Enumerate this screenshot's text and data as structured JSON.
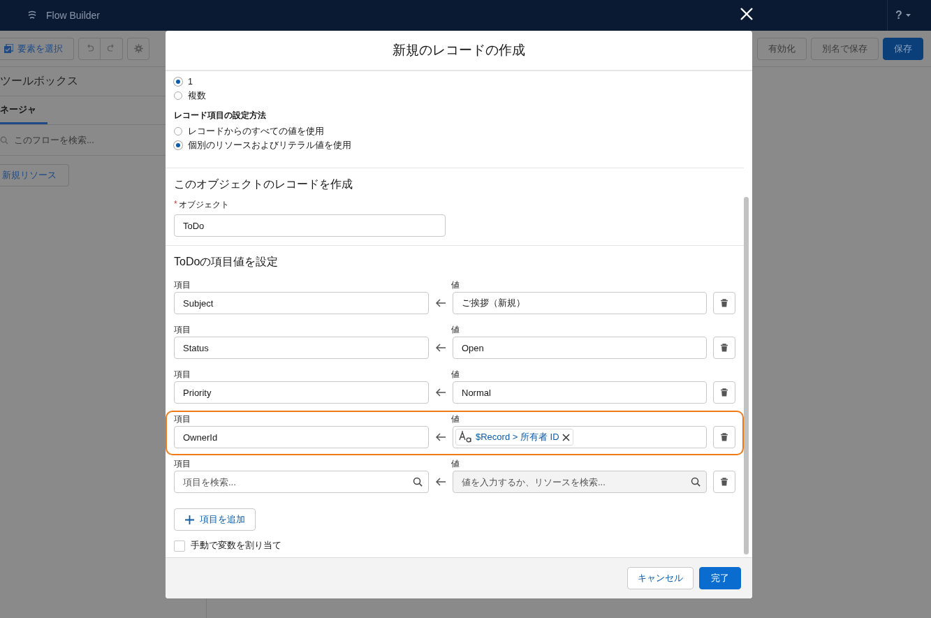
{
  "app_header": {
    "title": "Flow Builder",
    "help": "?"
  },
  "toolbar": {
    "select_button": "要素を選択",
    "right_buttons": [
      {
        "label": "有効化",
        "kind": "plain"
      },
      {
        "label": "別名で保存",
        "kind": "plain"
      },
      {
        "label": "保存",
        "kind": "primary"
      }
    ]
  },
  "sidebar": {
    "title": "ツールボックス",
    "tab": "ネージャ",
    "search": {
      "placeholder": "このフローを検索..."
    },
    "new_resource": "新規リソース"
  },
  "modal": {
    "title": "新規のレコードの作成",
    "record_count": [
      {
        "label": "1",
        "selected": true
      },
      {
        "label": "複数",
        "selected": false
      }
    ],
    "set_method": {
      "label": "レコード項目の設定方法",
      "options": [
        {
          "label": "レコードからのすべての値を使用",
          "selected": false
        },
        {
          "label": "個別のリソースおよびリテラル値を使用",
          "selected": true
        }
      ]
    },
    "object_section": {
      "heading": "このオブジェクトのレコードを作成",
      "label": "オブジェクト",
      "required_mark": "*",
      "value": "ToDo"
    },
    "assign_section": {
      "heading": "ToDoの項目値を設定",
      "rows": [
        {
          "kind": "text",
          "field_label": "項目",
          "field": "Subject",
          "value_label": "値",
          "value": "ご挨拶（新規）",
          "highlighted": false
        },
        {
          "kind": "text",
          "field_label": "項目",
          "field": "Status",
          "value_label": "値",
          "value": "Open",
          "highlighted": false
        },
        {
          "kind": "text",
          "field_label": "項目",
          "field": "Priority",
          "value_label": "値",
          "value": "Normal",
          "highlighted": false
        },
        {
          "kind": "resource",
          "field_label": "項目",
          "field": "OwnerId",
          "value_label": "値",
          "value": "$Record > 所有者 ID",
          "highlighted": true
        },
        {
          "kind": "search",
          "field_label": "項目",
          "field_placeholder": "項目を検索...",
          "value_label": "値",
          "value_placeholder": "値を入力するか、リソースを検索...",
          "highlighted": false
        }
      ],
      "add_button": "項目を追加"
    },
    "manual_assign": {
      "label": "手動で変数を割り当て",
      "checked": false
    },
    "buttons": [
      {
        "label": "キャンセル",
        "kind": "neutral"
      },
      {
        "label": "完了",
        "kind": "brand"
      }
    ]
  }
}
